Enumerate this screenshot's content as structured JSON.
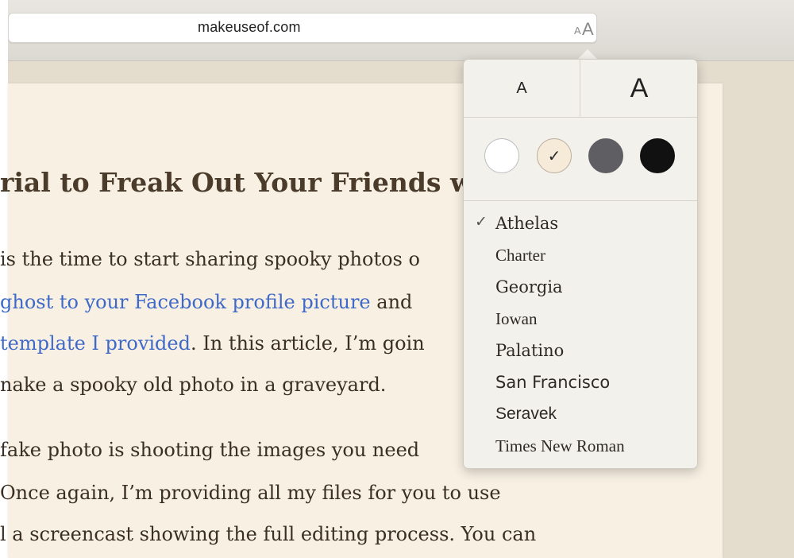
{
  "address_bar": {
    "url": "makeuseof.com",
    "reader_button": {
      "small_glyph": "A",
      "big_glyph": "A"
    }
  },
  "article": {
    "headline": "rial to Freak Out Your Friends wit",
    "lines": [
      {
        "segments": [
          {
            "text": " is the time to start sharing spooky photos o",
            "link": false
          }
        ]
      },
      {
        "segments": [
          {
            "text": "ghost to your Facebook profile picture",
            "link": true
          },
          {
            "text": " and ",
            "link": false
          }
        ]
      },
      {
        "segments": [
          {
            "text": "template I provided",
            "link": true
          },
          {
            "text": ". In this article, I’m goin",
            "link": false
          }
        ]
      },
      {
        "segments": [
          {
            "text": "nake a spooky old photo in a graveyard.",
            "link": false
          }
        ]
      },
      {
        "segments": [
          {
            "text": "fake photo is shooting the images you need",
            "link": false
          }
        ]
      },
      {
        "segments": [
          {
            "text": "Once again, I’m providing all my files for you to use",
            "link": false
          }
        ]
      },
      {
        "segments": [
          {
            "text": "l a screencast showing the full editing process. You can",
            "link": false
          }
        ]
      }
    ]
  },
  "popover": {
    "font_size": {
      "smaller_label": "A",
      "larger_label": "A"
    },
    "themes": [
      {
        "name": "white",
        "color": "#ffffff",
        "border": "#bdbdbd",
        "selected": false
      },
      {
        "name": "sepia",
        "color": "#f6ead8",
        "border": "#b9ad9b",
        "selected": true
      },
      {
        "name": "gray",
        "color": "#5f5f63",
        "border": "#5f5f63",
        "selected": false
      },
      {
        "name": "night",
        "color": "#111111",
        "border": "#111111",
        "selected": false
      }
    ],
    "selected_mark": "✓",
    "fonts": [
      {
        "name": "Athelas",
        "selected": true
      },
      {
        "name": "Charter",
        "selected": false
      },
      {
        "name": "Georgia",
        "selected": false
      },
      {
        "name": "Iowan",
        "selected": false
      },
      {
        "name": "Palatino",
        "selected": false
      },
      {
        "name": "San Francisco",
        "selected": false
      },
      {
        "name": "Seravek",
        "selected": false
      },
      {
        "name": "Times New Roman",
        "selected": false
      }
    ]
  },
  "colors": {
    "link": "#3f69c9",
    "page_background": "#f8f1e3",
    "reader_background": "#e4dccd"
  }
}
